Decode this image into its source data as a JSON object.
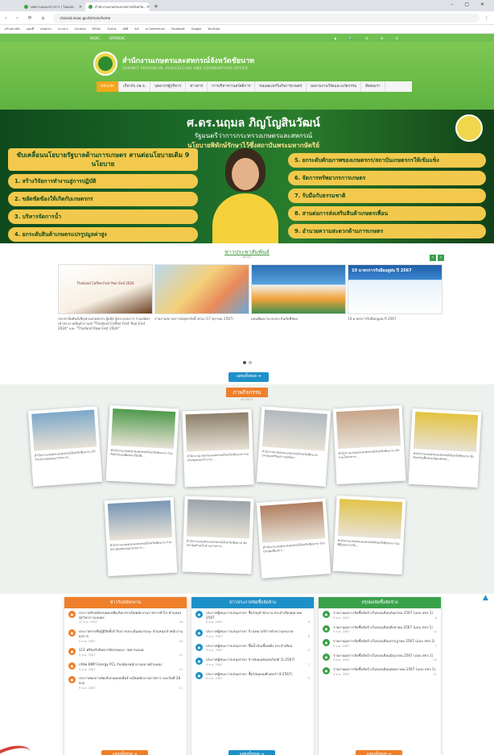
{
  "browser": {
    "tabs": [
      {
        "label": "บทความและข่าวสาร | โฮมเพจ"
      },
      {
        "label": "สำนักงานเกษตรและสหกรณ์จังหวัด..."
      }
    ],
    "new_tab": "+",
    "url": "chainat.moac.go.th/main/home",
    "bookmarks": [
      "สร้างทางลัด",
      "แผนที่",
      "เกษตรกร",
      "ข่าวสาร",
      "Chrome",
      "MOAC",
      "Forms",
      "สถิติ",
      "SIS",
      "e-Conference",
      "Facebook",
      "Google",
      "YouTube"
    ],
    "nav_glyphs": "‹ › ⟳ ⌂"
  },
  "topbar": {
    "links": [
      "MOAC",
      "OPSMOAC"
    ],
    "icons": "♟ 🔍 ☰ ✉ ✆"
  },
  "header": {
    "title": "สำนักงานเกษตรและสหกรณ์จังหวัดชัยนาท",
    "subtitle": "CHAINAT PROVINCIAL AGRICULTURE AND COOPERATIVES OFFICE",
    "nav": [
      "หน้าแรก",
      "เกี่ยวกับ กษ.จ.",
      "บุคลากรผู้บริหาร",
      "ข่าวสาร",
      "การบริหารงานสวัสดิการ",
      "ขอเผยแพร่ในกิจการเกษตร",
      "ผลงานงานวิจัยและนวัตกรรม",
      "ติดต่อเรา"
    ]
  },
  "banner": {
    "name": "ศ.ดร.นฤมล ภิญโญสินวัฒน์",
    "position": "รัฐมนตรีว่าการกระทรวงเกษตรและสหกรณ์",
    "policy": "นโยบายพิทักษ์รักษาไว้ซึ่งสถาบันพระมหากษัตริย์",
    "drive": "ขับเคลื่อนนโยบายรัฐบาลด้านการเกษตร สานต่อนโยบายเดิม 9 นโยบาย",
    "left_items": [
      "1. สร้างวิจัยการทำงานสู่การปฏิบัติ",
      "2. ขยัดขัดข้องให้เกิดกับเกษตรกร",
      "3. บริหารจัดการน้ำ",
      "4. ยกระดับสินค้าเกษตรแปรรูปมูลค่าสูง"
    ],
    "right_items": [
      "5. ยกระดับศักยภาพของเกษตรกร/สถาบันเกษตรกรให้เข้มแข็ง",
      "6. จัดการทรัพยากรการเกษตร",
      "7. รับมือกับธรรมชาติ",
      "8. สานต่อการส่งเสริมสินค้าเกษตรเพื่อน",
      "9. อำนวยความสะดวกด้านการเกษตร"
    ]
  },
  "news": {
    "title": "ข่าวประชาสัมพันธ์",
    "subtitle": "NEWS",
    "cards": [
      {
        "caption": "ประชาสัมพันธ์เชิญชวนเกษตรกร ผู้ผลิต ผู้ประกอบการ ร่วมสมัครเข้าประกวดสินค้ากาแฟ \"Thailand Coffee Fest Year End 2024\" และ \"Thailand Raw Fest 2024\"",
        "img": "Thailand Coffee Fest Year End 2024"
      },
      {
        "caption": "รายงานสถานการณ์อุทกภัยน้ำท่วม (17 ตุลาคม 2567)",
        "img": ""
      },
      {
        "caption": "แผนพัฒนาระบบประกันภัยพืชผล",
        "img": ""
      },
      {
        "caption": "10 มาตรการรับมือฤดูฝน ปี 2567",
        "img": "10 มาตรการรับมือฤดูฝน ปี 2567"
      }
    ],
    "more": "แสดงทั้งหมด ➔"
  },
  "activities": {
    "title": "ภาพกิจกรรม",
    "subtitle": "ACTIVITY",
    "items": [
      "สำนักงานเกษตรและสหกรณ์จังหวัดชัยนาท เข้าร่วมประชุมคณะกรรมการ...",
      "สำนักงานเกษตรและสหกรณ์จังหวัดชัยนาท ร่วมกิจกรรมเฉลิมพระเกียรติ...",
      "สำนักงานเกษตรและสหกรณ์จังหวัดชัยนาท ร่วมประชุมคณะทำงาน...",
      "สำนักงานเกษตรและสหกรณ์จังหวัดชัยนาท ประชุมเตรียมความพร้อม...",
      "สำนักงานเกษตรและสหกรณ์จังหวัดชัยนาท เข้าร่วมโครงการ...",
      "สำนักงานเกษตรและสหกรณ์จังหวัดชัยนาท จัดกิจกรรมสืบสานวัฒนธรรม...",
      "สำนักงานเกษตรและสหกรณ์จังหวัดชัยนาท ร่วมประชุมคณะอนุกรรมการ...",
      "สำนักงานเกษตรและสหกรณ์จังหวัดชัยนาท จัดประชุมหัวหน้าส่วนราชการ...",
      "สำนักงานเกษตรและสหกรณ์จังหวัดชัยนาท ร่วมประชุมสัมมนา...",
      "สำนักงานเกษตรและสหกรณ์จังหวัดชัยนาท ร่วมพิธีมอบรางวัล..."
    ]
  },
  "panels": [
    {
      "title": "ข่าวรับสมัครงาน",
      "color": "#ef7f2a",
      "items": [
        {
          "text": "ประกาศรับสมัครบุคคลเพื่อเลือกสรรเป็นพนักงานราชการทั่วไป ตำแหน่งนักวิชาการเกษตร",
          "date": "17 ต.ค. 2567",
          "views": "18"
        },
        {
          "text": "ประกาศรายชื่อผู้มีสิทธิ์เข้ารับการประเมินสมรรถนะ ตำแหน่งเจ้าพนักงานธุรการ",
          "date": "9 ต.ค. 2567",
          "views": "24"
        },
        {
          "text": "111 ฟรีชอร์ปปัดทารย์ทรงของก าคทารเมนต",
          "date": "9 ต.ค. 2567",
          "views": "12"
        },
        {
          "text": "บริษัท BMP Energy PCL รับสมัครพนักงานหลายตำแหน่ง",
          "date": "9 ต.ค. 2567",
          "views": "15"
        },
        {
          "text": "ประกาศผลการคัดเลือกบุคคลเพื่อจ้างเป็นพนักงานราชการ รอบวันที่ 28 ต.ค.",
          "date": "9 ต.ค. 2567",
          "views": "21"
        }
      ],
      "more": "แสดงทั้งหมด ➔"
    },
    {
      "title": "ข่าวประกาศจัดซื้อจัดจ้าง",
      "color": "#1e90c8",
      "items": [
        {
          "text": "ประกาศผู้ชนะการเสนอราคา ซื้อวัสดุสำนักงาน ประจำเดือนตุลาคม 2567",
          "date": "9 ต.ค. 2567",
          "views": "6"
        },
        {
          "text": "ประกาศผู้ชนะการเสนอราคา จ้างเหมาบริการทำความสะอาด",
          "date": "9 ต.ค. 2567",
          "views": "8"
        },
        {
          "text": "ประกาศผู้ชนะการเสนอราคา ซื้อน้ำมันเชื้อเพลิง ประจำเดือน",
          "date": "9 ต.ค. 2567",
          "views": "5"
        },
        {
          "text": "ประกาศผู้ชนะการเสนอราคา จ้างซ่อมแซมครุภัณฑ์ (1-2567)",
          "date": "9 ต.ค. 2567",
          "views": "7"
        },
        {
          "text": "ประกาศผู้ชนะการเสนอราคา ซื้อวัสดุคอมพิวเตอร์ (4-2567)",
          "date": "9 ต.ค. 2567",
          "views": "9"
        }
      ],
      "more": "แสดงทั้งหมด ➔"
    },
    {
      "title": "สรุปผลจัดซื้อจัดจ้าง",
      "color": "#3aa14a",
      "items": [
        {
          "text": "รายงานผลการจัดซื้อจัดจ้างในรอบเดือนกันยายน 2567 (แบบ สขร.1)",
          "date": "9 ต.ค. 2567",
          "views": "8"
        },
        {
          "text": "รายงานผลการจัดซื้อจัดจ้างในรอบเดือนสิงหาคม 2567 (แบบ สขร.1)",
          "date": "9 ต.ค. 2567",
          "views": "12"
        },
        {
          "text": "รายงานผลการจัดซื้อจัดจ้างในรอบเดือนกรกฎาคม 2567 (แบบ สขร.1)",
          "date": "9 ต.ค. 2567",
          "views": "7"
        },
        {
          "text": "รายงานผลการจัดซื้อจัดจ้างในรอบเดือนมิถุนายน 2567 (แบบ สขร.1)",
          "date": "9 ต.ค. 2567",
          "views": "10"
        },
        {
          "text": "รายงานผลการจัดซื้อจัดจ้างในรอบเดือนพฤษภาคม 2567 (แบบ สขร.1)",
          "date": "9 ต.ค. 2567",
          "views": "11"
        }
      ],
      "more": "แสดงทั้งหมด ➔"
    }
  ],
  "colors": {
    "brand_green": "#6fc051",
    "accent_orange": "#ef7f2a",
    "accent_blue": "#1e90c8"
  }
}
